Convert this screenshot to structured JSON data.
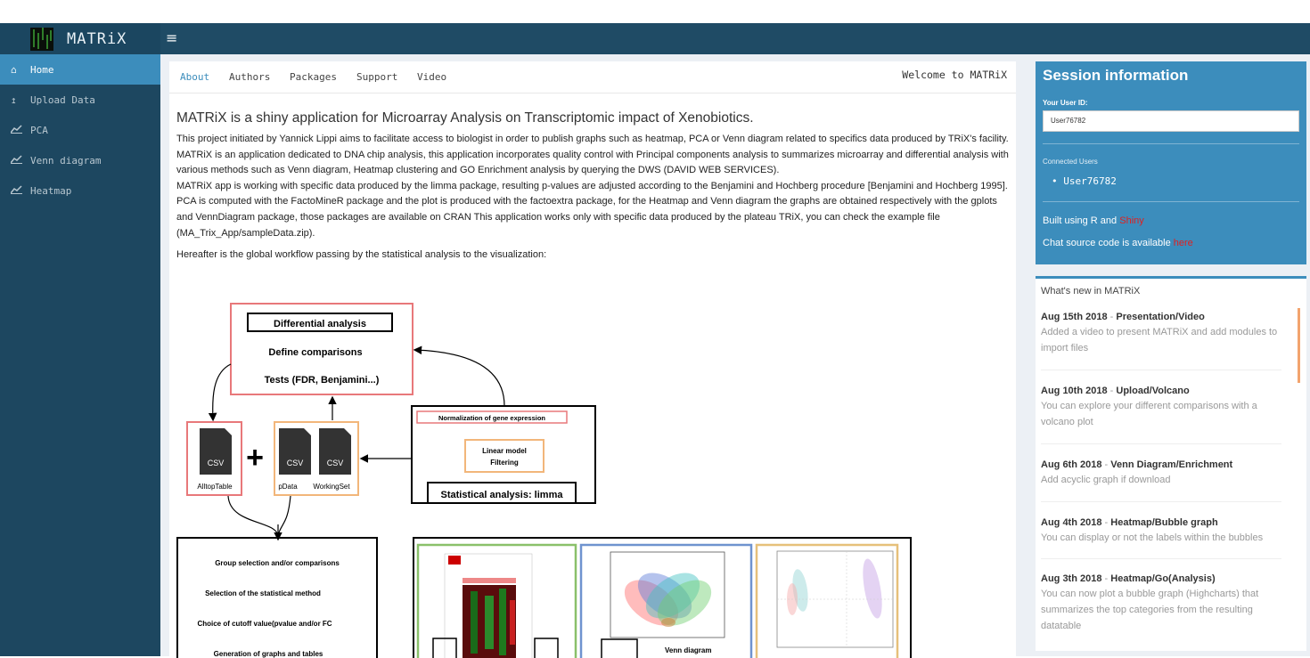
{
  "app": {
    "title": "MATRiX",
    "menu_icon": "hamburger-icon"
  },
  "sidebar": {
    "items": [
      {
        "label": "Home",
        "icon": "home-icon",
        "active": true
      },
      {
        "label": "Upload Data",
        "icon": "upload-icon",
        "active": false
      },
      {
        "label": "PCA",
        "icon": "line-chart-icon",
        "active": false
      },
      {
        "label": "Venn diagram",
        "icon": "line-chart-icon",
        "active": false
      },
      {
        "label": "Heatmap",
        "icon": "line-chart-icon",
        "active": false
      }
    ]
  },
  "main": {
    "tabs": [
      "About",
      "Authors",
      "Packages",
      "Support",
      "Video"
    ],
    "welcome": "Welcome to MATRiX",
    "heading": "MATRiX is a shiny application for Microarray Analysis on Transcriptomic impact of Xenobiotics.",
    "paragraphs": [
      "This project initiated by Yannick Lippi aims to facilitate access to biologist in order to publish graphs such as heatmap, PCA or Venn diagram related to specifics data produced by TRiX's facility.",
      "MATRiX is an application dedicated to DNA chip analysis, this application incorporates quality control with Principal components analysis to summarizes microarray and differential analysis with various methods such as Venn diagram, Heatmap clustering and GO Enrichment analysis by querying the DWS (DAVID WEB SERVICES).",
      "MATRiX app is working with specific data produced by the limma package, resulting p-values are adjusted according to the Benjamini and Hochberg procedure [Benjamini and Hochberg 1995]. PCA is computed with the FactoMineR package and the plot is produced with the factoextra package, for the Heatmap and Venn diagram the graphs are obtained respectively with the gplots and VennDiagram package, those packages are available on CRAN This application works only with specific data produced by the plateau TRiX, you can check the example file (MA_Trix_App/sampleData.zip).",
      "Hereafter is the global workflow passing by the statistical analysis to the visualization:"
    ],
    "workflow": {
      "diff_title": "Differential analysis",
      "define": "Define comparisons",
      "tests": "Tests (FDR, Benjamini...)",
      "csv": "CSV",
      "plus": "+",
      "file1": "AlltopTable",
      "file2": "pData",
      "file3": "WorkingSet",
      "norm": "Normalization of gene expression",
      "linear": "Linear model",
      "filtering": "Filtering",
      "stat": "Statistical analysis: limma",
      "group": "Group selection and/or comparisons",
      "method": "Selection of the statistical method",
      "cutoff": "Choice of cutoff value(pvalue and/or FC",
      "generation": "Generation of graphs and tables",
      "venn": "Venn diagram"
    }
  },
  "session": {
    "title": "Session information",
    "user_id_label": "Your User ID:",
    "user_id": "User76782",
    "connected_label": "Connected Users",
    "connected_users": [
      "User76782"
    ],
    "built_prefix": "Built using R and",
    "built_link": "Shiny",
    "chat_prefix": "Chat source code is available",
    "chat_link": "here"
  },
  "news": {
    "title": "What's new in MATRiX",
    "items": [
      {
        "date": "Aug 15th 2018",
        "topic": "Presentation/Video",
        "text": "Added a video to present MATRiX and add modules to import files"
      },
      {
        "date": "Aug 10th 2018",
        "topic": "Upload/Volcano",
        "text": "You can explore your different comparisons with a volcano plot"
      },
      {
        "date": "Aug 6th 2018",
        "topic": "Venn Diagram/Enrichment",
        "text": "Add acyclic graph if download"
      },
      {
        "date": "Aug 4th 2018",
        "topic": "Heatmap/Bubble graph",
        "text": "You can display or not the labels within the bubbles"
      },
      {
        "date": "Aug 3th 2018",
        "topic": "Heatmap/Go(Analysis)",
        "text": "You can now plot a bubble graph (Highcharts) that summarizes the top categories from the resulting datatable"
      }
    ]
  },
  "colors": {
    "header": "#1f4b65",
    "sidebar": "#1d4760",
    "accent": "#3c8dbc",
    "link_red": "#e02020"
  }
}
